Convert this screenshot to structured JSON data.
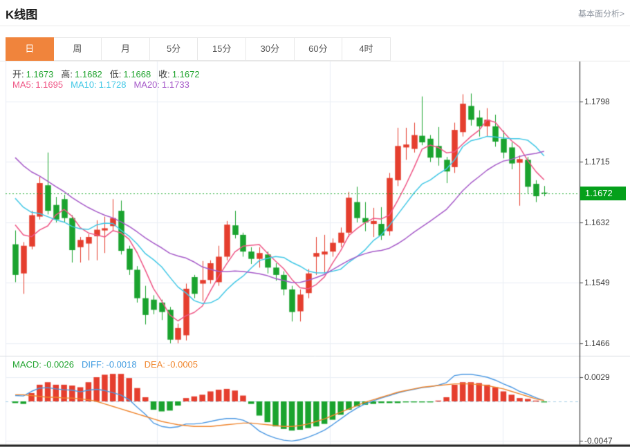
{
  "page": {
    "title": "K线图",
    "link": "基本面分析>"
  },
  "tabs": {
    "items": [
      "日",
      "周",
      "月",
      "5分",
      "15分",
      "30分",
      "60分",
      "4时"
    ],
    "selected_index": 0,
    "selected_color": "#f0843c"
  },
  "ohlc_legend": {
    "label_color": "#3c3c3c",
    "value_color": "#21a42f",
    "items": [
      {
        "label": "开:",
        "value": "1.1673"
      },
      {
        "label": "高:",
        "value": "1.1682"
      },
      {
        "label": "低:",
        "value": "1.1668"
      },
      {
        "label": "收:",
        "value": "1.1672"
      }
    ]
  },
  "ma_legend": {
    "items": [
      {
        "label": "MA5:",
        "value": "1.1695",
        "color": "#ef5585"
      },
      {
        "label": "MA10:",
        "value": "1.1728",
        "color": "#41c8e6"
      },
      {
        "label": "MA20:",
        "value": "1.1733",
        "color": "#a65ac9"
      }
    ]
  },
  "macd_legend": {
    "items": [
      {
        "label": "MACD:",
        "value": "-0.0026",
        "color": "#21a42f"
      },
      {
        "label": "DIFF:",
        "value": "-0.0018",
        "color": "#3f9be0"
      },
      {
        "label": "DEA:",
        "value": "-0.0005",
        "color": "#f0862d"
      }
    ]
  },
  "current_price": {
    "value": "1.1672",
    "badge_color": "#05a01b",
    "text_color": "#ffffff"
  },
  "chart_data": {
    "type": "candlestick",
    "title": "K线图 (daily K-line with MA5/MA10/MA20 and MACD)",
    "up_color": "#e53e2e",
    "down_color": "#1aa32e",
    "grid_color": "#e9eef5",
    "axis_color": "#3c3c3c",
    "dotted_line_color": "#0fa61f",
    "dotted_line_value": 1.1672,
    "y_axis": {
      "ticks": [
        {
          "label": "1.1798",
          "value": 1.1798
        },
        {
          "label": "1.1715",
          "value": 1.1715
        },
        {
          "label": "1.1632",
          "value": 1.1632
        },
        {
          "label": "1.1549",
          "value": 1.1549
        },
        {
          "label": "1.1466",
          "value": 1.1466
        }
      ]
    },
    "macd_axis": {
      "ticks": [
        {
          "label": "0.0029",
          "value": 0.0029
        },
        {
          "label": "-0.0047",
          "value": -0.0047
        }
      ]
    },
    "candles": [
      [
        1.1602,
        1.1621,
        1.155,
        1.156
      ],
      [
        1.1562,
        1.1605,
        1.1534,
        1.16
      ],
      [
        1.1599,
        1.1648,
        1.1595,
        1.1642
      ],
      [
        1.164,
        1.1695,
        1.1636,
        1.1686
      ],
      [
        1.1683,
        1.1728,
        1.1643,
        1.1648
      ],
      [
        1.1656,
        1.1667,
        1.1632,
        1.1636
      ],
      [
        1.1664,
        1.167,
        1.1632,
        1.1638
      ],
      [
        1.1638,
        1.1642,
        1.1577,
        1.1594
      ],
      [
        1.1598,
        1.1612,
        1.1577,
        1.1608
      ],
      [
        1.1603,
        1.1616,
        1.158,
        1.1612
      ],
      [
        1.1613,
        1.1635,
        1.158,
        1.1622
      ],
      [
        1.1621,
        1.164,
        1.159,
        1.1624
      ],
      [
        1.1627,
        1.1664,
        1.162,
        1.1638
      ],
      [
        1.1648,
        1.1662,
        1.1588,
        1.1593
      ],
      [
        1.1596,
        1.16,
        1.156,
        1.1567
      ],
      [
        1.1567,
        1.1572,
        1.1522,
        1.1528
      ],
      [
        1.1528,
        1.1545,
        1.1492,
        1.1505
      ],
      [
        1.1526,
        1.1532,
        1.1506,
        1.1512
      ],
      [
        1.1522,
        1.1526,
        1.1498,
        1.1509
      ],
      [
        1.1512,
        1.1516,
        1.1466,
        1.1471
      ],
      [
        1.1471,
        1.1493,
        1.1466,
        1.1487
      ],
      [
        1.1477,
        1.1548,
        1.147,
        1.1541
      ],
      [
        1.1557,
        1.156,
        1.1528,
        1.1534
      ],
      [
        1.1548,
        1.1579,
        1.1524,
        1.1553
      ],
      [
        1.1553,
        1.158,
        1.1548,
        1.1576
      ],
      [
        1.155,
        1.16,
        1.1545,
        1.1585
      ],
      [
        1.1585,
        1.1634,
        1.158,
        1.1629
      ],
      [
        1.1628,
        1.1648,
        1.161,
        1.1615
      ],
      [
        1.1615,
        1.1618,
        1.1585,
        1.1592
      ],
      [
        1.1592,
        1.1598,
        1.1575,
        1.1582
      ],
      [
        1.1582,
        1.1598,
        1.157,
        1.159
      ],
      [
        1.1588,
        1.1592,
        1.1562,
        1.157
      ],
      [
        1.157,
        1.1576,
        1.1552,
        1.156
      ],
      [
        1.156,
        1.1565,
        1.1532,
        1.154
      ],
      [
        1.154,
        1.1545,
        1.1496,
        1.1509
      ],
      [
        1.151,
        1.154,
        1.1496,
        1.1533
      ],
      [
        1.1535,
        1.1568,
        1.1528,
        1.1562
      ],
      [
        1.1585,
        1.1612,
        1.156,
        1.159
      ],
      [
        1.1588,
        1.1615,
        1.1562,
        1.1592
      ],
      [
        1.1592,
        1.161,
        1.1585,
        1.1604
      ],
      [
        1.1604,
        1.1625,
        1.1598,
        1.1618
      ],
      [
        1.1618,
        1.1674,
        1.1612,
        1.1666
      ],
      [
        1.166,
        1.1681,
        1.1632,
        1.1638
      ],
      [
        1.1638,
        1.166,
        1.162,
        1.1632
      ],
      [
        1.163,
        1.1652,
        1.1612,
        1.1634
      ],
      [
        1.163,
        1.1653,
        1.1608,
        1.1614
      ],
      [
        1.162,
        1.17,
        1.1614,
        1.1693
      ],
      [
        1.169,
        1.1762,
        1.1682,
        1.1737
      ],
      [
        1.1735,
        1.1762,
        1.1718,
        1.1739
      ],
      [
        1.1733,
        1.1769,
        1.1728,
        1.1752
      ],
      [
        1.1751,
        1.1805,
        1.1738,
        1.1742
      ],
      [
        1.1747,
        1.1752,
        1.1715,
        1.1721
      ],
      [
        1.1737,
        1.1763,
        1.171,
        1.1721
      ],
      [
        1.1718,
        1.1722,
        1.1686,
        1.1702
      ],
      [
        1.1708,
        1.1769,
        1.17,
        1.1759
      ],
      [
        1.1756,
        1.1808,
        1.175,
        1.1795
      ],
      [
        1.1792,
        1.1809,
        1.1765,
        1.1773
      ],
      [
        1.1776,
        1.1786,
        1.175,
        1.1764
      ],
      [
        1.1764,
        1.1789,
        1.175,
        1.1773
      ],
      [
        1.1764,
        1.178,
        1.1736,
        1.1743
      ],
      [
        1.1747,
        1.1758,
        1.172,
        1.1728
      ],
      [
        1.1735,
        1.1742,
        1.1705,
        1.1713
      ],
      [
        1.1714,
        1.1724,
        1.1655,
        1.1719
      ],
      [
        1.1718,
        1.1722,
        1.1672,
        1.1681
      ],
      [
        1.1685,
        1.169,
        1.166,
        1.1668
      ],
      [
        1.1673,
        1.1682,
        1.1668,
        1.1672
      ]
    ],
    "ma_prehistory_closes": [
      1.1822,
      1.1812,
      1.1802,
      1.1792,
      1.1782,
      1.1772,
      1.1762,
      1.1752,
      1.1742,
      1.1732,
      1.1722,
      1.1712,
      1.1702,
      1.1692,
      1.168,
      1.1668,
      1.1655,
      1.164,
      1.162
    ],
    "ma_series": [
      {
        "name": "MA5",
        "period": 5,
        "color": "#ef5585"
      },
      {
        "name": "MA10",
        "period": 10,
        "color": "#41c8e6"
      },
      {
        "name": "MA20",
        "period": 20,
        "color": "#a65ac9"
      }
    ],
    "macd": {
      "diff_color": "#4a98e3",
      "dea_color": "#f0852d",
      "zero_line_color": "#a8cfe8",
      "histogram": [
        -0.0002,
        -0.0003,
        0.001,
        0.002,
        0.0023,
        0.002,
        0.002,
        0.0019,
        0.0017,
        0.0023,
        0.0029,
        0.0032,
        0.0033,
        0.0033,
        0.0028,
        0.0016,
        0.0005,
        -0.001,
        -0.0012,
        -0.0011,
        -0.0005,
        0.0004,
        0.0006,
        0.0008,
        0.0012,
        0.0014,
        0.0015,
        0.0013,
        0.0007,
        -0.0003,
        -0.0017,
        -0.0025,
        -0.003,
        -0.0033,
        -0.0035,
        -0.0034,
        -0.0032,
        -0.003,
        -0.0027,
        -0.0022,
        -0.0016,
        -0.001,
        -0.0006,
        -0.0004,
        -0.0003,
        -0.0002,
        -0.0002,
        -0.0002,
        -0.0001,
        -0.0001,
        -0.0001,
        -0.0001,
        0.0001,
        0.0005,
        0.002,
        0.0023,
        0.0023,
        0.0022,
        0.002,
        0.0017,
        0.0012,
        0.0008,
        0.0004,
        0.0003,
        0.0001,
        0.0
      ],
      "diff": [
        0.0007,
        0.00065,
        0.0012,
        0.0016,
        0.00165,
        0.0015,
        0.0014,
        0.00135,
        0.00115,
        0.00135,
        0.00145,
        0.0013,
        0.00105,
        0.00075,
        0.0002,
        -0.0007,
        -0.00155,
        -0.0026,
        -0.003,
        -0.00315,
        -0.00305,
        -0.0027,
        -0.0027,
        -0.0026,
        -0.0024,
        -0.0022,
        -0.00205,
        -0.00205,
        -0.00225,
        -0.00275,
        -0.00355,
        -0.00405,
        -0.0044,
        -0.00465,
        -0.00475,
        -0.0046,
        -0.0043,
        -0.0039,
        -0.00345,
        -0.0028,
        -0.0021,
        -0.0014,
        -0.0008,
        -0.0003,
        5e-05,
        0.0004,
        0.0007,
        0.001,
        0.00125,
        0.00145,
        0.00165,
        0.00175,
        0.00195,
        0.00225,
        0.0031,
        0.00325,
        0.00325,
        0.0031,
        0.0029,
        0.00255,
        0.0021,
        0.0017,
        0.0012,
        0.00085,
        0.00045,
        0.0001
      ],
      "dea": [
        0.0008,
        0.0008,
        0.0007,
        0.0006,
        0.0005,
        0.0005,
        0.0004,
        0.0004,
        0.0003,
        0.0002,
        0.0,
        -0.0003,
        -0.0006,
        -0.0009,
        -0.0012,
        -0.0015,
        -0.0018,
        -0.0021,
        -0.0024,
        -0.0026,
        -0.0028,
        -0.0029,
        -0.003,
        -0.003,
        -0.003,
        -0.0029,
        -0.0028,
        -0.0027,
        -0.0026,
        -0.0026,
        -0.0027,
        -0.0028,
        -0.0029,
        -0.003,
        -0.003,
        -0.0029,
        -0.0027,
        -0.0024,
        -0.0021,
        -0.0017,
        -0.0013,
        -0.0009,
        -0.0005,
        -0.0001,
        0.0002,
        0.0005,
        0.0008,
        0.0011,
        0.0013,
        0.0015,
        0.0017,
        0.0018,
        0.0019,
        0.002,
        0.0021,
        0.0021,
        0.0021,
        0.002,
        0.0019,
        0.0017,
        0.0015,
        0.0012,
        0.0009,
        0.0006,
        0.0003,
        0.0001
      ]
    }
  }
}
